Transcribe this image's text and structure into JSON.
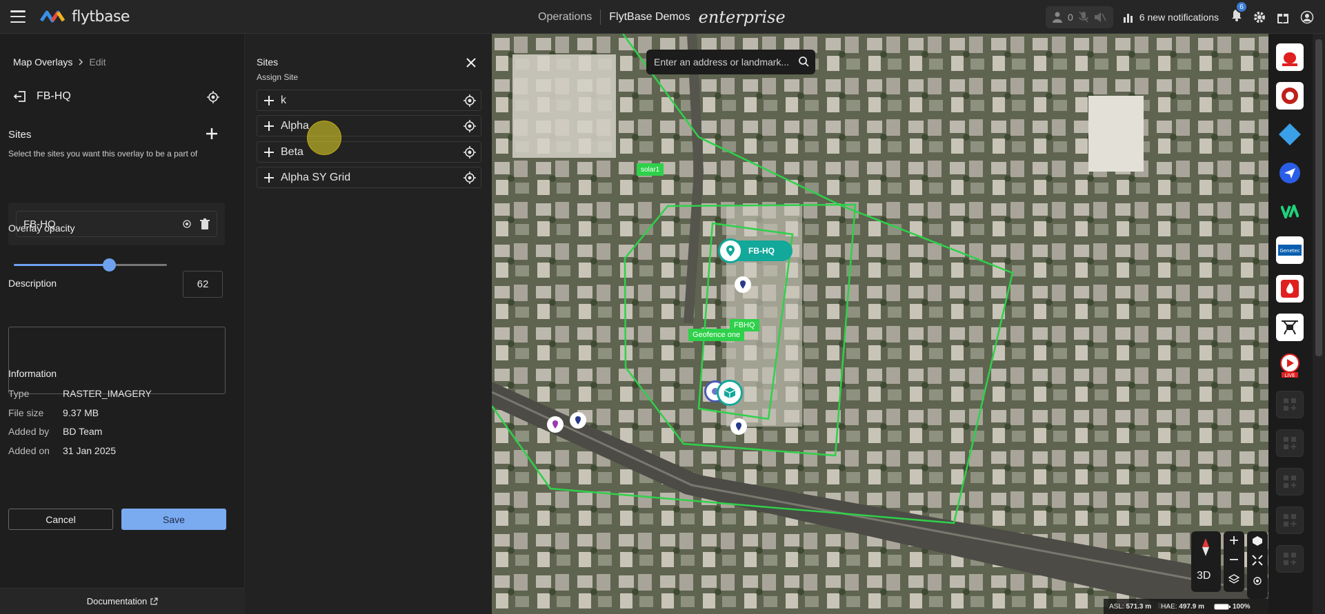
{
  "topbar": {
    "brand": "flytbase",
    "nav_operations": "Operations",
    "org_name": "FlytBase Demos",
    "edition": "enterprise",
    "user_count": "0",
    "notifications_label": "6 new notifications",
    "notif_badge": "6"
  },
  "left": {
    "breadcrumb_root": "Map Overlays",
    "breadcrumb_current": "Edit",
    "overlay_name": "FB-HQ",
    "sites_title": "Sites",
    "sites_subtitle": "Select the sites you want this overlay to be a part of",
    "assigned_site": "FB-HQ",
    "opacity_label": "Overlay opacity",
    "opacity_value": "62",
    "opacity_fraction": 0.62,
    "description_label": "Description",
    "description_value": "",
    "info_title": "Information",
    "info": [
      {
        "key": "Type",
        "value": "RASTER_IMAGERY"
      },
      {
        "key": "File size",
        "value": "9.37 MB"
      },
      {
        "key": "Added by",
        "value": "BD Team"
      },
      {
        "key": "Added on",
        "value": "31 Jan 2025"
      }
    ],
    "cancel_label": "Cancel",
    "save_label": "Save",
    "documentation_label": "Documentation"
  },
  "sites_panel": {
    "title": "Sites",
    "subtitle": "Assign Site",
    "items": [
      "k",
      "Alpha",
      "Beta",
      "Alpha SY Grid"
    ]
  },
  "map": {
    "search_placeholder": "Enter an address or landmark...",
    "labels": {
      "site_pin": "FB-HQ",
      "solar": "solar1",
      "fbhq": "FBHQ",
      "geofence": "Geofence one"
    },
    "mode_3d": "3D",
    "asl_label": "ASL:",
    "asl_value": "571.3 m",
    "hae_label": "HAE:",
    "hae_value": "497.9 m",
    "battery": "100%",
    "geofence_color": "#2ed14a"
  },
  "colors": {
    "accent": "#7aaaf0",
    "geofence": "#2ed14a",
    "teal": "#12a89a"
  }
}
